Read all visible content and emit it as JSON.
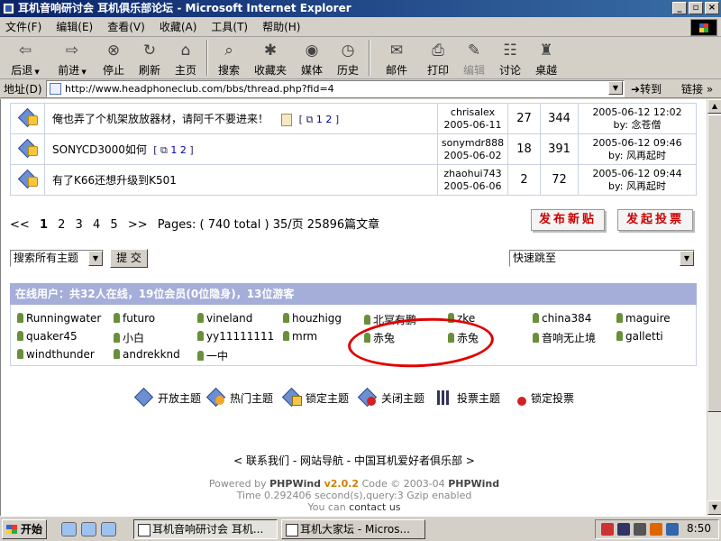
{
  "window": {
    "title": "耳机音响研讨会 耳机俱乐部论坛 - Microsoft Internet Explorer",
    "buttons": [
      "_",
      "▫",
      "×"
    ]
  },
  "menu": [
    "文件(F)",
    "编辑(E)",
    "查看(V)",
    "收藏(A)",
    "工具(T)",
    "帮助(H)"
  ],
  "toolbar": {
    "back": "后退",
    "forward": "前进",
    "stop": "停止",
    "refresh": "刷新",
    "home": "主页",
    "search": "搜索",
    "favorites": "收藏夹",
    "media": "媒体",
    "history": "历史",
    "mail": "邮件",
    "print": "打印",
    "edit": "编辑",
    "discuss": "讨论",
    "desktop": "桌越"
  },
  "address": {
    "label": "地址(D)",
    "url": "http://www.headphoneclub.com/bbs/thread.php?fid=4",
    "go": "转到",
    "links": "链接"
  },
  "threads": [
    {
      "title": "俺也弄了个机架放放器材，请阿千不要进来！",
      "pages": "1 2",
      "attach": true,
      "author": "chrisalex",
      "date": "2005-06-11",
      "replies": "27",
      "views": "344",
      "last_time": "2005-06-12 12:02",
      "last_by": "by: 念苍僧"
    },
    {
      "title": "SONYCD3000如何",
      "pages": "1 2",
      "attach": false,
      "author": "sonymdr888",
      "date": "2005-06-02",
      "replies": "18",
      "views": "391",
      "last_time": "2005-06-12 09:46",
      "last_by": "by: 风再起时"
    },
    {
      "title": "有了K66还想升级到K501",
      "pages": "",
      "attach": false,
      "author": "zhaohui743",
      "date": "2005-06-06",
      "replies": "2",
      "views": "72",
      "last_time": "2005-06-12 09:44",
      "last_by": "by: 风再起时"
    }
  ],
  "pager": {
    "first": "<<",
    "current": "1",
    "pages": [
      "2",
      "3",
      "4",
      "5"
    ],
    "next": ">>",
    "summary": "Pages: ( 740 total )  35/页 25896篇文章"
  },
  "actions": {
    "new_topic": "发布新贴",
    "new_poll": "发起投票"
  },
  "search": {
    "select": "搜索所有主题",
    "submit": "提 交"
  },
  "jump": {
    "select": "快速跳至"
  },
  "online": {
    "header": "在线用户：共32人在线，19位会员(0位隐身)，13位游客",
    "members": [
      "Runningwater",
      "futuro",
      "vineland",
      "houzhigg",
      "北冥有鹏",
      "zke",
      "china384",
      "maguire",
      "quaker45",
      "小白",
      "yy11111111",
      "mrm",
      "赤兔",
      "赤兔",
      "音响无止境",
      "galletti",
      "windthunder",
      "andrekknd",
      "一中"
    ]
  },
  "legend": [
    "开放主题",
    "热门主题",
    "锁定主题",
    "关闭主题",
    "投票主题",
    "锁定投票"
  ],
  "footer": {
    "links": "< 联系我们 - 网站导航 - 中国耳机爱好者俱乐部 >",
    "powered": "Powered by",
    "brand": "PHPWind",
    "version": "v2.0.2",
    "code": "Code © 2003-04",
    "brand2": "PHPWind",
    "time": "Time 0.292406 second(s),query:3 Gzip enabled",
    "contact_pre": "You can",
    "contact": "contact us"
  },
  "taskbar": {
    "start": "开始",
    "tasks": [
      "耳机音响研讨会 耳机...",
      "耳机大家坛 - Micros..."
    ],
    "clock": "8:50"
  },
  "colors": {
    "online_header": "#a5aed9",
    "circle": "#e00000",
    "action_text": "#cc0000"
  }
}
